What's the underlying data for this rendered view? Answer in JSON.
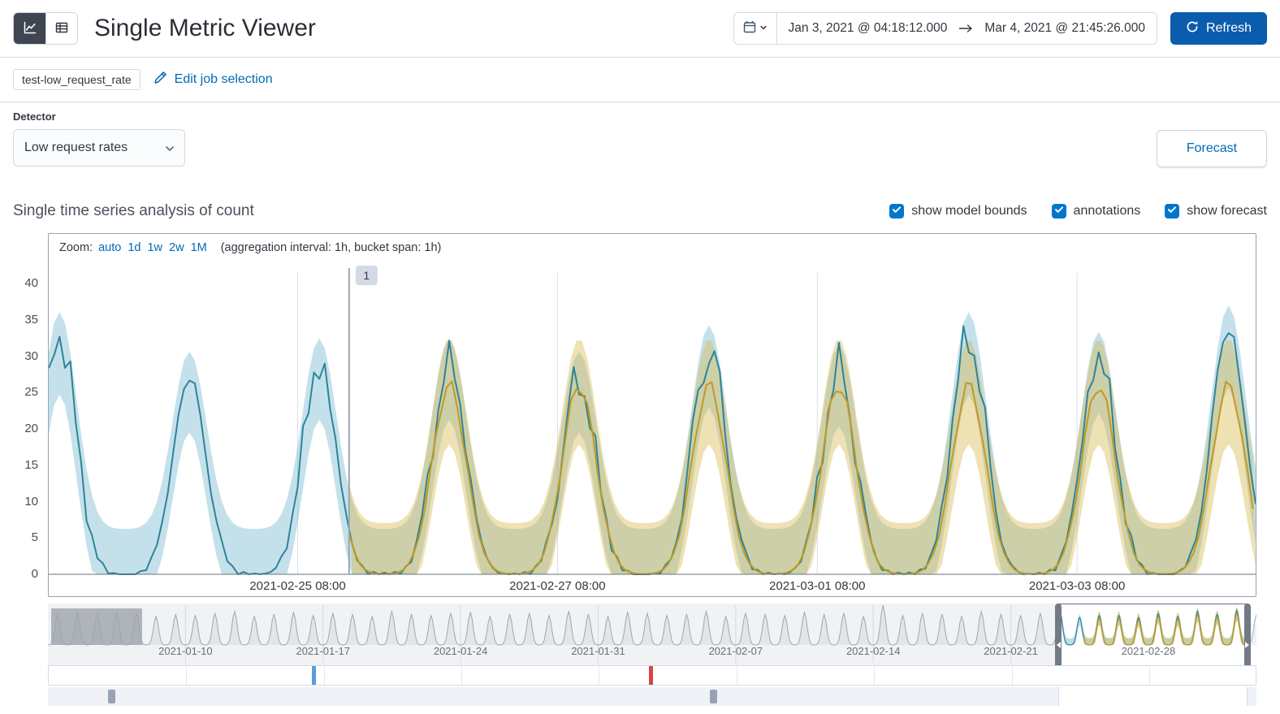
{
  "colors": {
    "primary_link": "#006bb4",
    "primary_button_fill": "#0b5cad",
    "checkbox_fill": "#0077cc",
    "actual_line": "#2f8399",
    "model_bounds_band": "#57a8c7",
    "forecast_line": "#c5991f",
    "forecast_bounds_band": "#d6b84a",
    "annotation_badge_bg": "#d3dae6",
    "context_annotation_blue": "#5a9bd8",
    "context_annotation_red": "#d64541"
  },
  "icons": {
    "view_chart": "line-chart-icon",
    "view_table": "table-icon",
    "calendar": "calendar-icon",
    "quick_select_caret": "chevron-down-icon",
    "range_arrow": "arrow-right-icon",
    "refresh": "refresh-icon",
    "edit": "pencil-icon",
    "select_caret": "chevron-down-icon",
    "checkbox_check": "check-icon",
    "brush_left": "arrow-left-handle",
    "brush_right": "arrow-right-handle"
  },
  "header": {
    "title": "Single Metric Viewer",
    "date_range": {
      "start": "Jan 3, 2021 @ 04:18:12.000",
      "end": "Mar 4, 2021 @ 21:45:26.000"
    },
    "refresh_label": "Refresh"
  },
  "job_bar": {
    "job_badge": "test-low_request_rate",
    "edit_link": "Edit job selection"
  },
  "detector": {
    "label": "Detector",
    "selected_option": "Low request rates",
    "forecast_button": "Forecast"
  },
  "series_section": {
    "heading": "Single time series analysis of count",
    "checkboxes": [
      {
        "label": "show model bounds",
        "checked": true
      },
      {
        "label": "annotations",
        "checked": true
      },
      {
        "label": "show forecast",
        "checked": true
      }
    ]
  },
  "main_chart": {
    "zoom_label": "Zoom:",
    "zoom_links": [
      "auto",
      "1d",
      "1w",
      "2w",
      "1M"
    ],
    "aggregation_note": "(aggregation interval: 1h, bucket span: 1h)",
    "annotation_badge": "1"
  },
  "chart_data": [
    {
      "type": "line",
      "role": "main",
      "title": "Single time series analysis of count",
      "ylabel": "count",
      "ylim": [
        0,
        42
      ],
      "yticks": [
        0,
        5,
        10,
        15,
        20,
        25,
        30,
        35,
        40
      ],
      "x_unit": "hours from 2021-02-23 10:00",
      "t_domain": [
        0,
        223
      ],
      "xticks": [
        {
          "t": 46,
          "label": "2021-02-25 08:00"
        },
        {
          "t": 94,
          "label": "2021-02-27 08:00"
        },
        {
          "t": 142,
          "label": "2021-03-01 08:00"
        },
        {
          "t": 190,
          "label": "2021-03-03 08:00"
        }
      ],
      "seasonal_period_hours": 24,
      "peak_phase_hour": 2,
      "peak_width_hours": 4.4,
      "series": [
        {
          "name": "actual",
          "color": "#2f8399",
          "day_peak_values": [
            33,
            27,
            29,
            29,
            27,
            31,
            28,
            33,
            30,
            34
          ]
        },
        {
          "name": "forecast",
          "color": "#c5991f",
          "start_t": 55.5,
          "day_peak_values": [
            26,
            25,
            26,
            26,
            26,
            26,
            26,
            26,
            26,
            26
          ]
        },
        {
          "name": "model bounds",
          "band": true,
          "color": "#57a8c7"
        },
        {
          "name": "forecast bounds",
          "band": true,
          "color": "#d6b84a"
        }
      ],
      "annotations": [
        {
          "id": "1",
          "t": 55.5
        }
      ]
    },
    {
      "type": "area",
      "role": "context",
      "x_unit": "hours from 2021-01-03 00:00",
      "t_domain": [
        0,
        1476
      ],
      "xticks": [
        {
          "t": 168,
          "label": "2021-01-10"
        },
        {
          "t": 336,
          "label": "2021-01-17"
        },
        {
          "t": 504,
          "label": "2021-01-24"
        },
        {
          "t": 672,
          "label": "2021-01-31"
        },
        {
          "t": 840,
          "label": "2021-02-07"
        },
        {
          "t": 1008,
          "label": "2021-02-14"
        },
        {
          "t": 1176,
          "label": "2021-02-21"
        },
        {
          "t": 1344,
          "label": "2021-02-28"
        }
      ],
      "seasonal_period_hours": 24,
      "peak_phase_hour": 12,
      "peak_width_hours": 4.4,
      "day_peaks": [
        30,
        31,
        30,
        32,
        31,
        28,
        30,
        29,
        31,
        33,
        28,
        30,
        32,
        29,
        31,
        30,
        28,
        33,
        30,
        29,
        31,
        32,
        28,
        30,
        31,
        29,
        33,
        30,
        28,
        32,
        31,
        29,
        30,
        33,
        28,
        31,
        30,
        29,
        32,
        30,
        31,
        28,
        39,
        29,
        31,
        30,
        28,
        33,
        30,
        29,
        31,
        33,
        27,
        29,
        29,
        27,
        31,
        28,
        33,
        30,
        34,
        30
      ],
      "gap_shade_t": [
        4,
        115
      ],
      "selection_t": [
        1234,
        1465
      ],
      "forecast_start_t": 1265,
      "annotation_markers": [
        {
          "t": 323,
          "color": "#5a9bd8"
        },
        {
          "t": 735,
          "color": "#d64541"
        }
      ],
      "scrollbar_markers": [
        {
          "t": 73
        },
        {
          "t": 808
        }
      ]
    }
  ]
}
